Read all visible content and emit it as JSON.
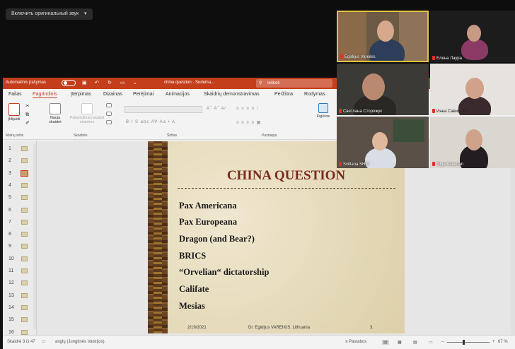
{
  "zoom": {
    "original_sound_label": "Включить оригинальный звук"
  },
  "ppt": {
    "autosave_label": "Automatinis įrašymas",
    "doc_title": "china question · Sudeina...",
    "search_placeholder": "Ieškoti",
    "tabs": [
      "Failas",
      "Pagrindinis",
      "Įterpimas",
      "Dizainas",
      "Perėjimai",
      "Animacijos",
      "Skaidrių demonstravimas",
      "Peržiūra",
      "Rodymas"
    ],
    "ribbon": {
      "paste_label": "Įklijuoti",
      "new_slide_label": "Nauja skaidrė",
      "reuse_label": "Pakartotinai naudoti skaidres",
      "figures_label": "Figūros",
      "group_clipboard": "Mainų sritis",
      "group_slides": "Skaidrės",
      "group_font": "Šriftas",
      "group_paragraph": "Pastraipa"
    },
    "thumbnails": [
      "1",
      "2",
      "3",
      "4",
      "5",
      "6",
      "7",
      "8",
      "9",
      "10",
      "11",
      "12",
      "13",
      "14",
      "15",
      "16"
    ],
    "active_slide_index": 3,
    "slide": {
      "title": "CHINA QUESTION",
      "bullets": [
        "Pax Americana",
        "Pax Europeana",
        "Dragon (and Bear?)",
        "BRICS",
        "“Orvelian“ dictatorship",
        "Califate",
        "Mesias"
      ],
      "footer_date": "2/19/2021",
      "footer_author": "Dr. Egidijus VAREIKIS, Lithuania",
      "footer_page": "3."
    },
    "status": {
      "slide_counter": "Skaidrė 3 iš 47",
      "language": "anglų (Jungtinės Valstijos)",
      "notes_label": "Pastabos",
      "zoom_pct": "67 %"
    }
  },
  "participants": [
    {
      "name": "Egidijus Vareikis"
    },
    {
      "name": "Елена Лаура"
    },
    {
      "name": "Светлана Сторожук"
    },
    {
      "name": "Инна Савицька"
    },
    {
      "name": "Svitlana SHKI"
    },
    {
      "name": "Olga Kalaman"
    }
  ],
  "colors": {
    "ppt_accent": "#c43e1c",
    "slide_title": "#7a2c1e",
    "mic_muted": "#e0302a"
  }
}
